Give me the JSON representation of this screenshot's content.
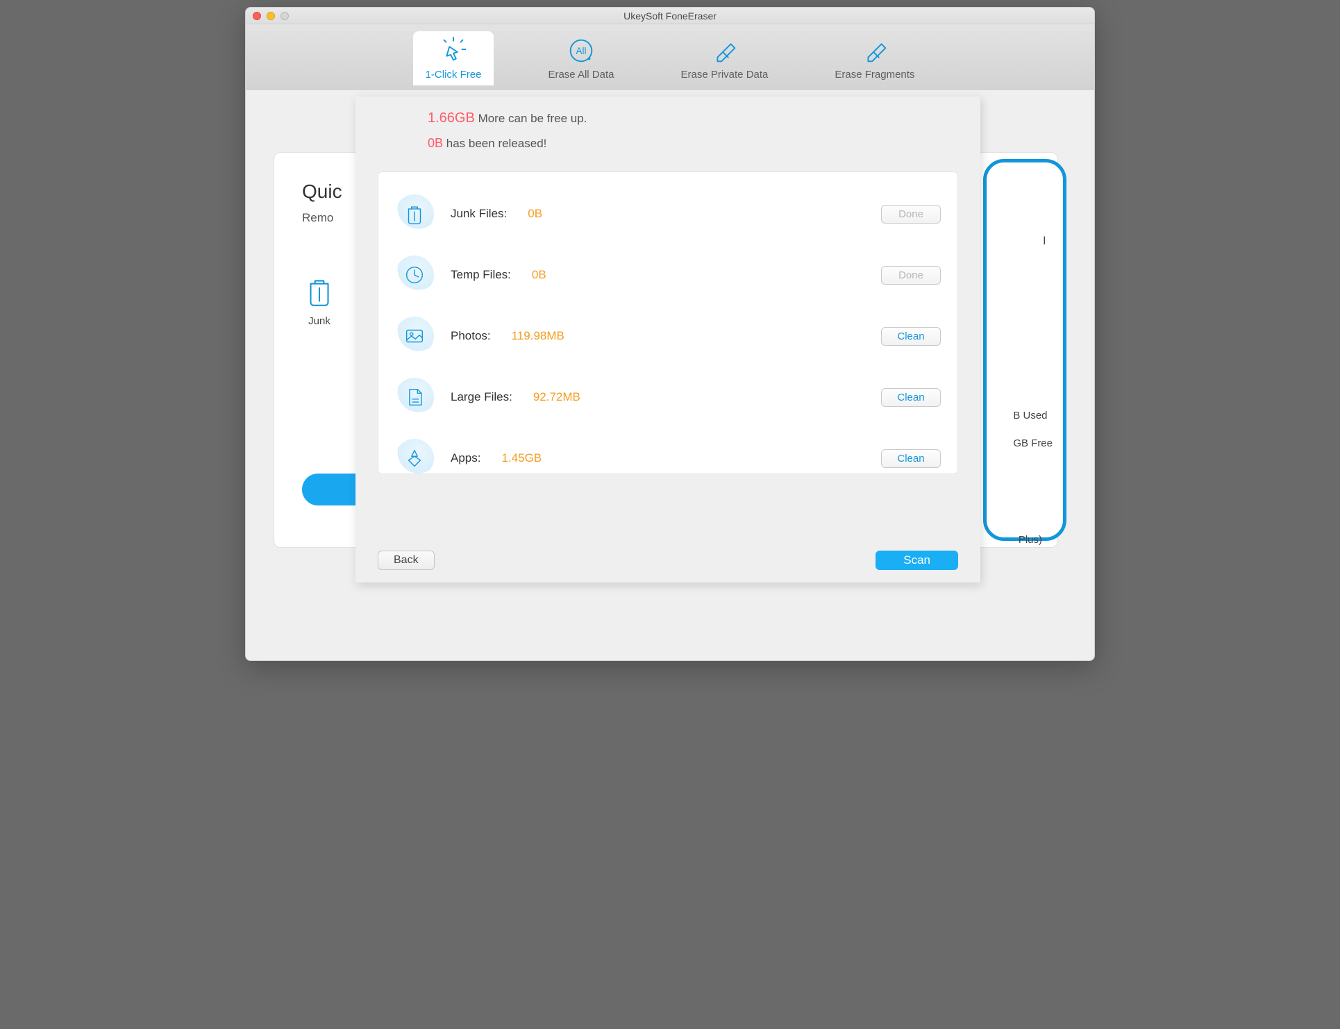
{
  "window": {
    "title": "UkeySoft FoneEraser"
  },
  "tabs": [
    {
      "label": "1-Click Free"
    },
    {
      "label": "Erase All Data"
    },
    {
      "label": "Erase Private Data"
    },
    {
      "label": "Erase Fragments"
    }
  ],
  "summary": {
    "free_amount": "1.66GB",
    "free_suffix": " More can be free up.",
    "released_amount": "0B",
    "released_suffix": " has been released!"
  },
  "rows": [
    {
      "label": "Junk Files:",
      "value": "0B",
      "button": "Done",
      "state": "disabled"
    },
    {
      "label": "Temp Files:",
      "value": "0B",
      "button": "Done",
      "state": "disabled"
    },
    {
      "label": "Photos:",
      "value": "119.98MB",
      "button": "Clean",
      "state": "enabled"
    },
    {
      "label": "Large Files:",
      "value": "92.72MB",
      "button": "Clean",
      "state": "enabled"
    },
    {
      "label": "Apps:",
      "value": "1.45GB",
      "button": "Clean",
      "state": "enabled"
    }
  ],
  "footer": {
    "back": "Back",
    "scan": "Scan"
  },
  "background": {
    "heading": "Quic",
    "sub": "Remo",
    "item1": "Junk",
    "used_suffix": "B Used",
    "free_suffix": "GB Free",
    "model_suffix": "Plus)",
    "l_suffix": "l"
  }
}
